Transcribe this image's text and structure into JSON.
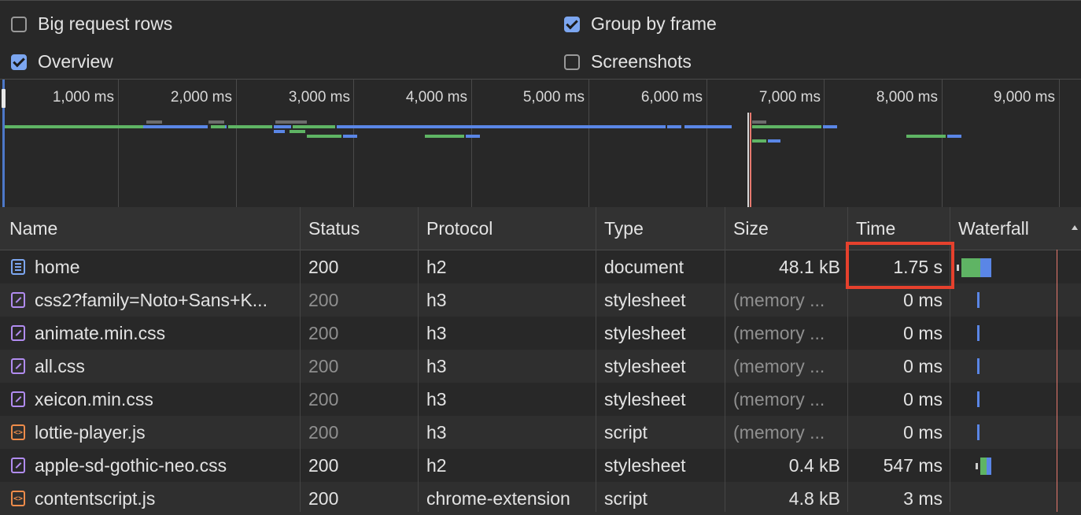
{
  "settings": {
    "big_request_rows": {
      "label": "Big request rows",
      "checked": false
    },
    "overview": {
      "label": "Overview",
      "checked": true
    },
    "group_by_frame": {
      "label": "Group by frame",
      "checked": true
    },
    "screenshots": {
      "label": "Screenshots",
      "checked": false
    }
  },
  "overview": {
    "ticks": [
      "1,000 ms",
      "2,000 ms",
      "3,000 ms",
      "4,000 ms",
      "5,000 ms",
      "6,000 ms",
      "7,000 ms",
      "8,000 ms",
      "9,000 ms"
    ]
  },
  "table": {
    "headers": {
      "name": "Name",
      "status": "Status",
      "protocol": "Protocol",
      "type": "Type",
      "size": "Size",
      "time": "Time",
      "waterfall": "Waterfall"
    },
    "rows": [
      {
        "name": "home",
        "icon": "document-icon",
        "status": "200",
        "protocol": "h2",
        "type": "document",
        "size": "48.1 kB",
        "time": "1.75 s"
      },
      {
        "name": "css2?family=Noto+Sans+K...",
        "icon": "stylesheet-icon",
        "status": "200",
        "protocol": "h3",
        "type": "stylesheet",
        "size": "(memory ...",
        "time": "0 ms"
      },
      {
        "name": "animate.min.css",
        "icon": "stylesheet-icon",
        "status": "200",
        "protocol": "h3",
        "type": "stylesheet",
        "size": "(memory ...",
        "time": "0 ms"
      },
      {
        "name": "all.css",
        "icon": "stylesheet-icon",
        "status": "200",
        "protocol": "h3",
        "type": "stylesheet",
        "size": "(memory ...",
        "time": "0 ms"
      },
      {
        "name": "xeicon.min.css",
        "icon": "stylesheet-icon",
        "status": "200",
        "protocol": "h3",
        "type": "stylesheet",
        "size": "(memory ...",
        "time": "0 ms"
      },
      {
        "name": "lottie-player.js",
        "icon": "script-icon",
        "status": "200",
        "protocol": "h3",
        "type": "script",
        "size": "(memory ...",
        "time": "0 ms"
      },
      {
        "name": "apple-sd-gothic-neo.css",
        "icon": "stylesheet-icon",
        "status": "200",
        "protocol": "h2",
        "type": "stylesheet",
        "size": "0.4 kB",
        "time": "547 ms"
      },
      {
        "name": "contentscript.js",
        "icon": "script-icon",
        "status": "200",
        "protocol": "chrome-extension",
        "type": "script",
        "size": "4.8 kB",
        "time": "3 ms"
      }
    ]
  },
  "colors": {
    "highlight": "#e6412d",
    "accent": "#7ca6f0",
    "waiting": "#5fb464",
    "download": "#5a86e6"
  }
}
